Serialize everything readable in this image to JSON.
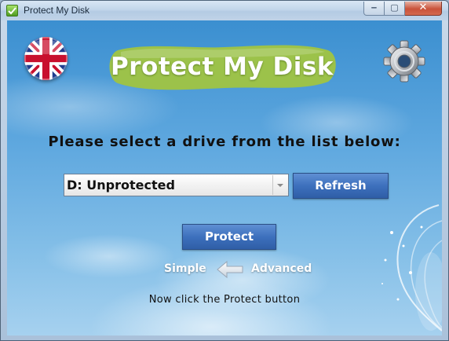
{
  "window": {
    "title": "Protect My Disk",
    "controls": {
      "minimize": "‒",
      "maximize": "▢",
      "close": "✕"
    }
  },
  "header": {
    "language_icon": "uk-flag-icon",
    "settings_icon": "gear-icon",
    "logo_text": "Protect My Disk"
  },
  "main": {
    "prompt": "Please select a drive from the list below:",
    "drive_select": {
      "value": "D: Unprotected"
    },
    "refresh_label": "Refresh",
    "protect_label": "Protect",
    "mode": {
      "simple": "Simple",
      "advanced": "Advanced",
      "arrow_icon": "arrow-left-icon"
    },
    "hint": "Now click the Protect button"
  },
  "colors": {
    "button_blue": "#3d70bd",
    "logo_green": "#9cc24a",
    "sky_blue": "#5fa8df"
  }
}
